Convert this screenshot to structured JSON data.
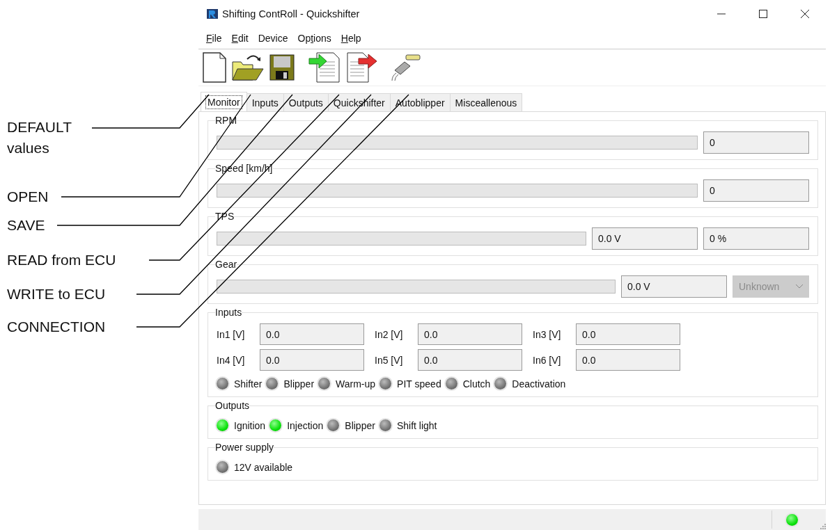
{
  "annotations": [
    {
      "label": "DEFAULT values"
    },
    {
      "label": "OPEN"
    },
    {
      "label": "SAVE"
    },
    {
      "label": "READ from ECU"
    },
    {
      "label": "WRITE to ECU"
    },
    {
      "label": "CONNECTION"
    }
  ],
  "window": {
    "title": "Shifting ContRoll - Quickshifter"
  },
  "menu": [
    {
      "key": "F",
      "after": "ile"
    },
    {
      "key": "E",
      "after": "dit"
    },
    {
      "before": "Device"
    },
    {
      "before": "Op",
      "key": "t",
      "after": "ions"
    },
    {
      "key": "H",
      "after": "elp"
    }
  ],
  "toolbar": [
    {
      "kind": "new"
    },
    {
      "kind": "open"
    },
    {
      "kind": "save"
    },
    {
      "kind": "read"
    },
    {
      "kind": "write"
    },
    {
      "kind": "connection"
    }
  ],
  "tabs": [
    {
      "label": "Monitor",
      "selected": true
    },
    {
      "label": "Inputs",
      "selected": false
    },
    {
      "label": "Outputs",
      "selected": false
    },
    {
      "label": "Quickshifter",
      "selected": false
    },
    {
      "label": "Autoblipper",
      "selected": false
    },
    {
      "label": "Misceallenous",
      "selected": false
    }
  ],
  "gauges": [
    {
      "title": "RPM",
      "level": 0,
      "readings": [
        "0"
      ]
    },
    {
      "title": "Speed [km/h]",
      "level": 0,
      "readings": [
        "0"
      ]
    },
    {
      "title": "TPS",
      "level": 0,
      "readings": [
        "0.0 V",
        "0 %"
      ]
    },
    {
      "title": "Gear",
      "level": 0,
      "readings": [
        "0.0 V"
      ],
      "dropdown": {
        "value": "Unknown",
        "disabled": true
      }
    }
  ],
  "inputs": {
    "title": "Inputs",
    "fields": [
      {
        "label": "In1 [V]",
        "value": "0.0"
      },
      {
        "label": "In2 [V]",
        "value": "0.0"
      },
      {
        "label": "In3 [V]",
        "value": "0.0"
      },
      {
        "label": "In4 [V]",
        "value": "0.0"
      },
      {
        "label": "In5 [V]",
        "value": "0.0"
      },
      {
        "label": "In6 [V]",
        "value": "0.0"
      }
    ],
    "indicators": [
      {
        "label": "Shifter",
        "on": false
      },
      {
        "label": "Blipper",
        "on": false
      },
      {
        "label": "Warm-up",
        "on": false
      },
      {
        "label": "PIT speed",
        "on": false
      },
      {
        "label": "Clutch",
        "on": false
      },
      {
        "label": "Deactivation",
        "on": false
      }
    ]
  },
  "outputs": {
    "title": "Outputs",
    "indicators": [
      {
        "label": "Ignition",
        "on": true
      },
      {
        "label": "Injection",
        "on": true
      },
      {
        "label": "Blipper",
        "on": false
      },
      {
        "label": "Shift light",
        "on": false
      }
    ]
  },
  "power_supply": {
    "title": "Power supply",
    "indicators": [
      {
        "label": "12V available",
        "on": false
      }
    ]
  },
  "status_bar": {
    "connected": true
  }
}
